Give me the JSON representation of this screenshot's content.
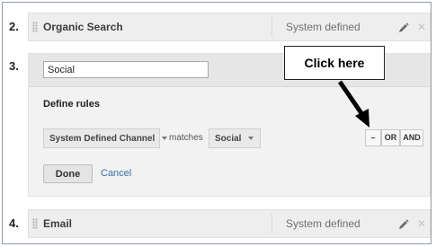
{
  "rows": {
    "organic": {
      "number": "2.",
      "name": "Organic Search",
      "type": "System defined"
    },
    "social": {
      "number": "3.",
      "name_value": "Social"
    },
    "email": {
      "number": "4.",
      "name": "Email",
      "type": "System defined"
    }
  },
  "editor": {
    "define_rules": "Define rules",
    "dimension": "System Defined Channel",
    "operator": "matches",
    "value": "Social",
    "remove_label": "–",
    "or_label": "OR",
    "and_label": "AND",
    "done_label": "Done",
    "cancel_label": "Cancel"
  },
  "callout": {
    "text": "Click here"
  },
  "icons": {
    "edit": "pencil-icon",
    "delete": "close-icon",
    "drag": "drag-handle-icon",
    "dropdown": "caret-down-icon"
  }
}
